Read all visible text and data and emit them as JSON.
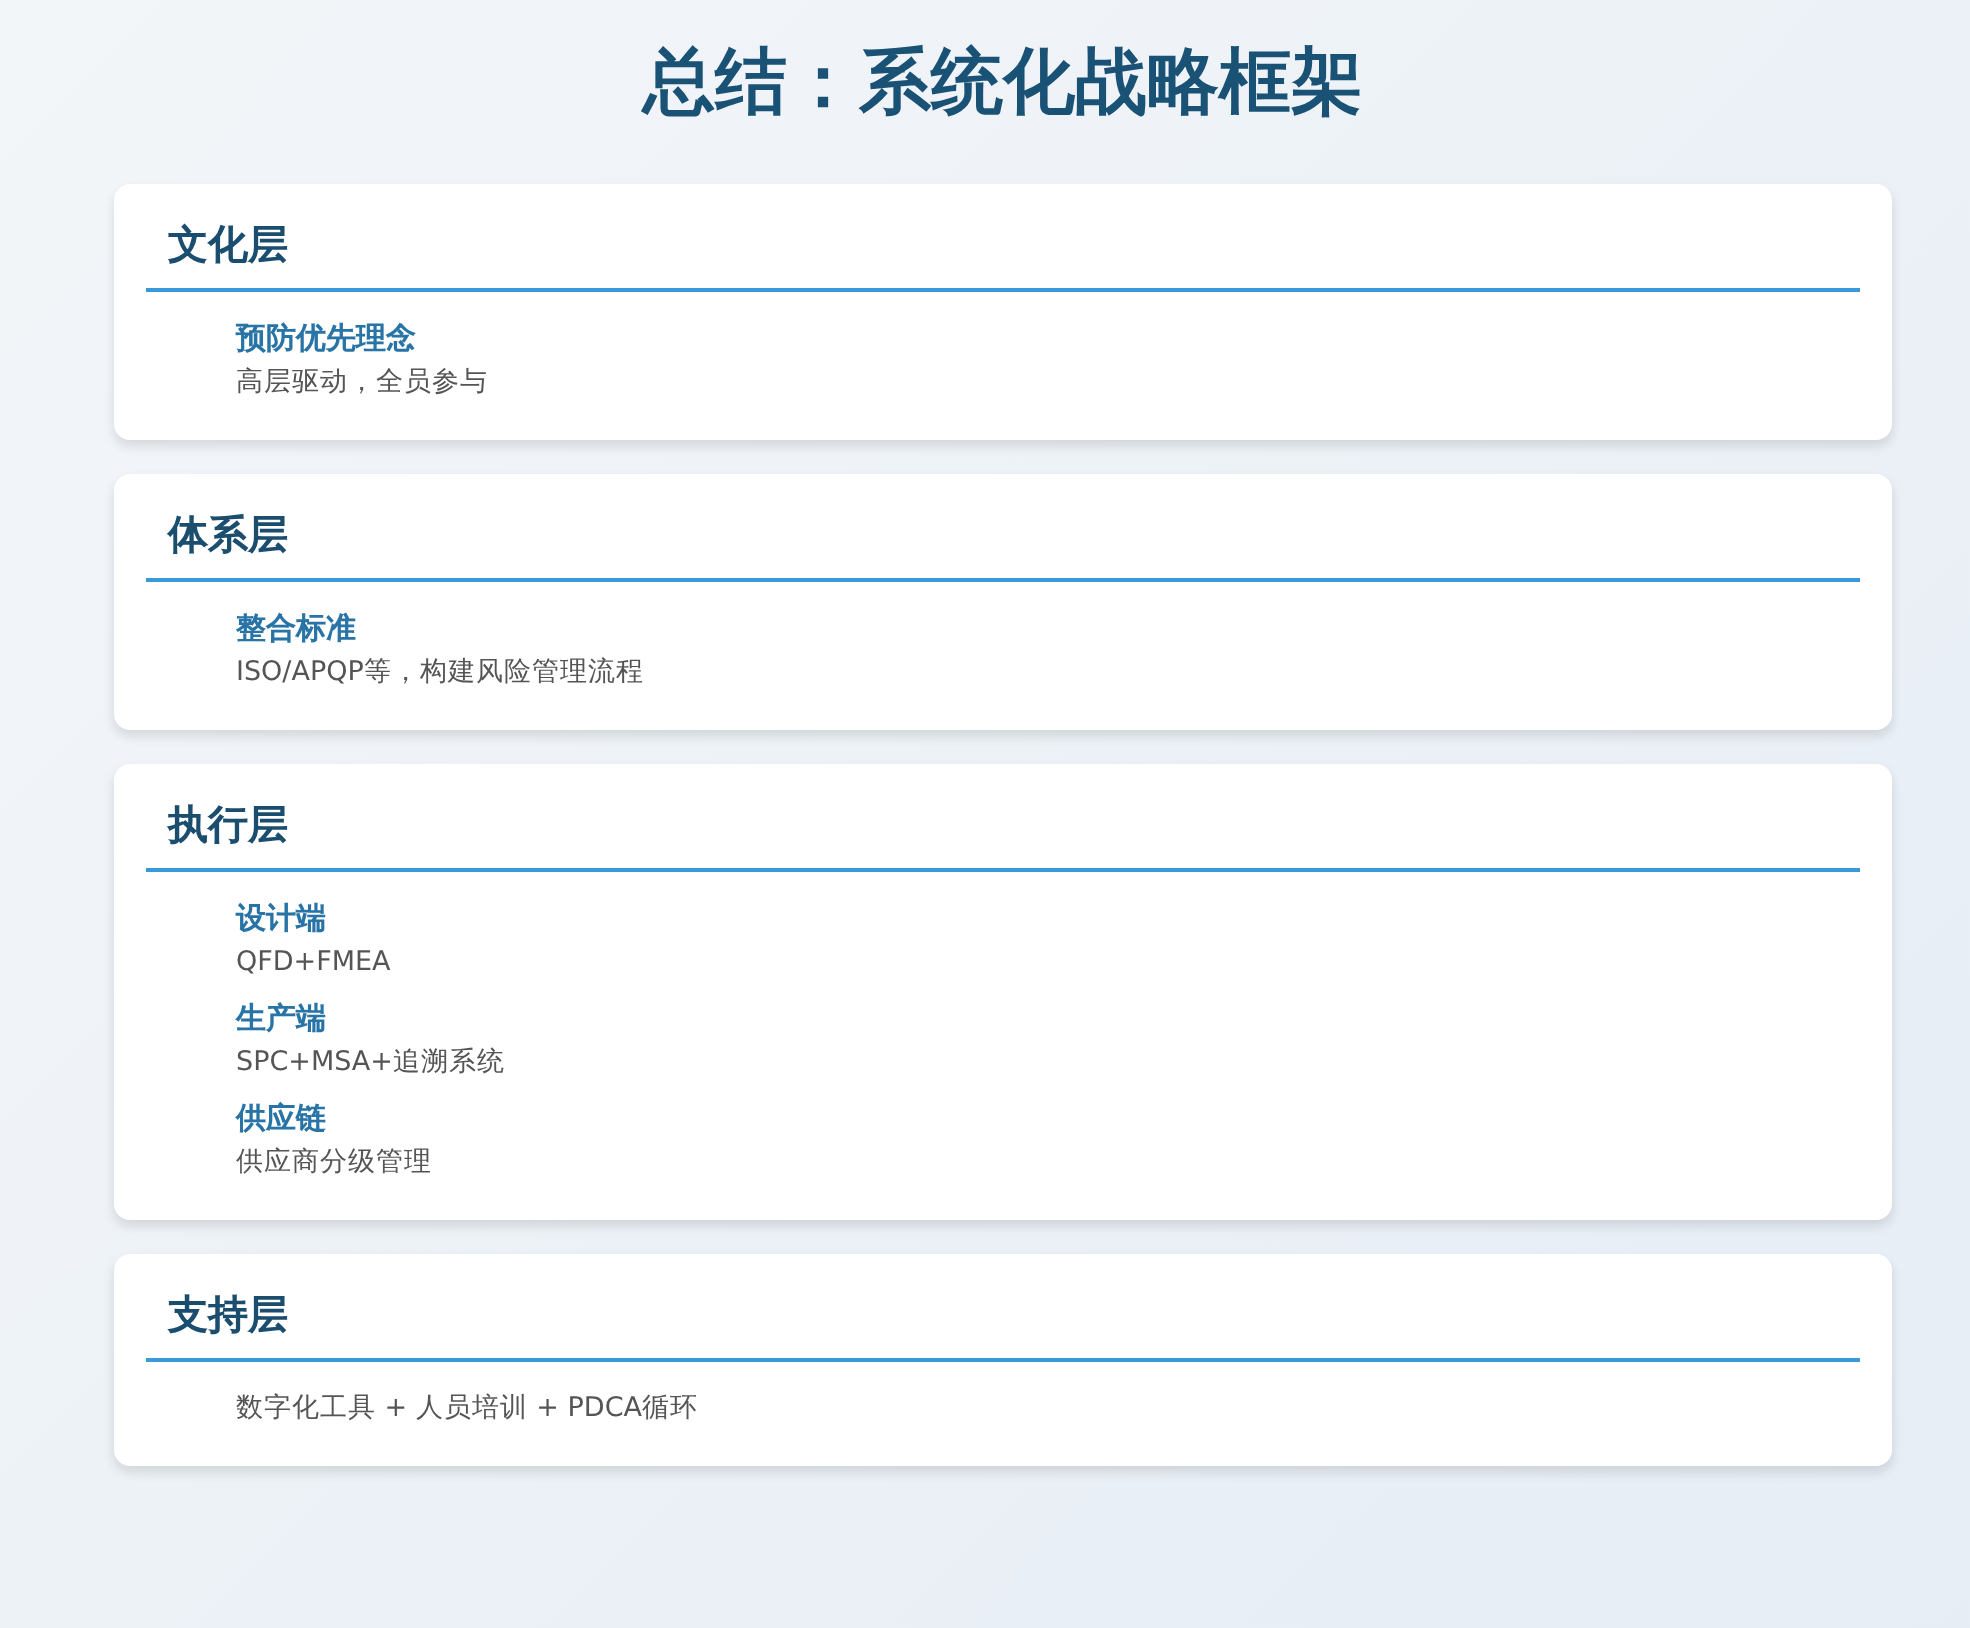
{
  "title": "总结：系统化战略框架",
  "layers": [
    {
      "heading": "文化层",
      "items": [
        {
          "title": "预防优先理念",
          "desc": "高层驱动，全员参与"
        }
      ]
    },
    {
      "heading": "体系层",
      "items": [
        {
          "title": "整合标准",
          "desc": "ISO/APQP等，构建风险管理流程"
        }
      ]
    },
    {
      "heading": "执行层",
      "items": [
        {
          "title": "设计端",
          "desc": "QFD+FMEA"
        },
        {
          "title": "生产端",
          "desc": "SPC+MSA+追溯系统"
        },
        {
          "title": "供应链",
          "desc": "供应商分级管理"
        }
      ]
    },
    {
      "heading": "支持层",
      "items": [
        {
          "desc": "数字化工具 + 人员培训 + PDCA循环"
        }
      ]
    }
  ]
}
